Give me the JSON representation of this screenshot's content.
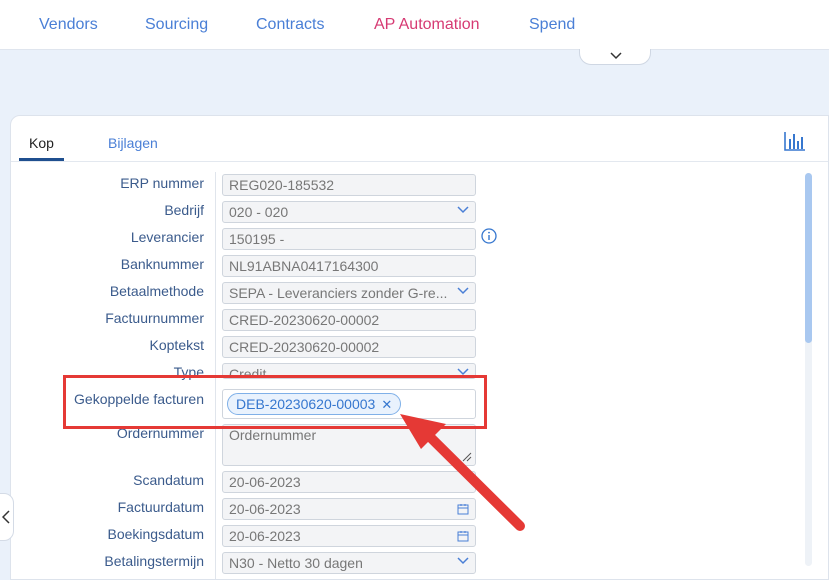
{
  "nav": {
    "items": [
      "Vendors",
      "Sourcing",
      "Contracts",
      "AP Automation",
      "Spend"
    ],
    "active": "AP Automation"
  },
  "tabs": {
    "kop": "Kop",
    "bijlagen": "Bijlagen"
  },
  "form": {
    "erp_nummer": {
      "label": "ERP nummer",
      "value": "REG020-185532"
    },
    "bedrijf": {
      "label": "Bedrijf",
      "value": "020 - 020"
    },
    "leverancier": {
      "label": "Leverancier",
      "value": "150195 -"
    },
    "banknummer": {
      "label": "Banknummer",
      "value": "NL91ABNA0417164300"
    },
    "betaalmethode": {
      "label": "Betaalmethode",
      "value": "SEPA - Leveranciers zonder G-re..."
    },
    "factuurnummer": {
      "label": "Factuurnummer",
      "value": "CRED-20230620-00002"
    },
    "koptekst": {
      "label": "Koptekst",
      "value": "CRED-20230620-00002"
    },
    "type": {
      "label": "Type",
      "value": "Credit"
    },
    "gekoppelde_facturen": {
      "label": "Gekoppelde facturen",
      "tag": "DEB-20230620-00003"
    },
    "ordernummer": {
      "label": "Ordernummer",
      "placeholder": "Ordernummer"
    },
    "scandatum": {
      "label": "Scandatum",
      "value": "20-06-2023"
    },
    "factuurdatum": {
      "label": "Factuurdatum",
      "value": "20-06-2023"
    },
    "boekingsdatum": {
      "label": "Boekingsdatum",
      "value": "20-06-2023"
    },
    "betalingstermijn": {
      "label": "Betalingstermijn",
      "value": "N30 - Netto 30 dagen"
    }
  },
  "colors": {
    "accent": "#4a7fd6",
    "active_nav": "#d63a73",
    "highlight": "#e53935"
  }
}
